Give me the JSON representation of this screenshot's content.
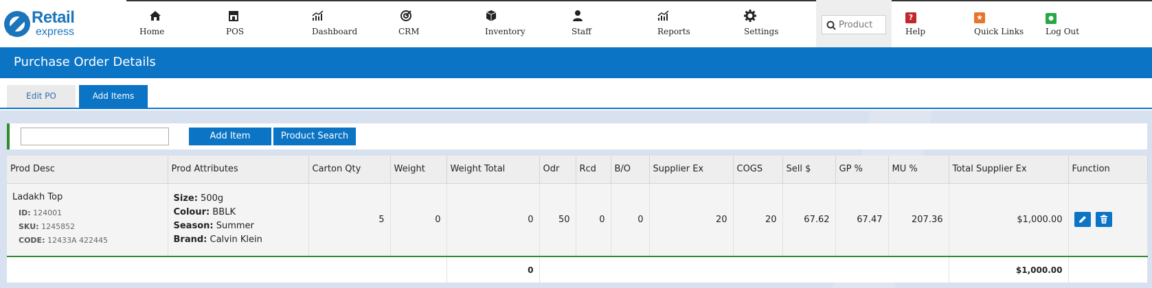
{
  "brand": {
    "line1": "Retail",
    "line2": "express"
  },
  "nav": {
    "items": [
      {
        "label": "Home",
        "icon": "home-icon"
      },
      {
        "label": "POS",
        "icon": "store-icon"
      },
      {
        "label": "Dashboard",
        "icon": "bar-chart-icon"
      },
      {
        "label": "CRM",
        "icon": "target-icon"
      },
      {
        "label": "Inventory",
        "icon": "box-icon"
      },
      {
        "label": "Staff",
        "icon": "user-icon"
      },
      {
        "label": "Reports",
        "icon": "bar-chart-icon"
      },
      {
        "label": "Settings",
        "icon": "gear-icon"
      }
    ],
    "search_placeholder": "Product",
    "right_items": [
      {
        "label": "Help",
        "icon": "help-icon",
        "color": "#c0282d",
        "glyph": "?"
      },
      {
        "label": "Quick Links",
        "icon": "star-icon",
        "color": "#e8742a",
        "glyph": "★"
      },
      {
        "label": "Log Out",
        "icon": "logout-user-icon",
        "color": "#28a745",
        "glyph": "●"
      }
    ]
  },
  "page": {
    "title": "Purchase Order Details"
  },
  "tabs": [
    {
      "label": "Edit PO",
      "active": false
    },
    {
      "label": "Add Items",
      "active": true
    }
  ],
  "toolbar": {
    "input_value": "",
    "add_item_label": "Add Item",
    "product_search_label": "Product Search"
  },
  "table": {
    "headers": [
      "Prod Desc",
      "Prod Attributes",
      "Carton Qty",
      "Weight",
      "Weight Total",
      "Odr",
      "Rcd",
      "B/O",
      "Supplier Ex",
      "COGS",
      "Sell $",
      "GP %",
      "MU %",
      "Total Supplier Ex",
      "Function"
    ],
    "rows": [
      {
        "name": "Ladakh Top",
        "id_label": "ID:",
        "id": "124001",
        "sku_label": "SKU:",
        "sku": "1245852",
        "code_label": "CODE:",
        "code": "12433A 422445",
        "attributes": [
          {
            "key": "Size:",
            "value": "500g"
          },
          {
            "key": "Colour:",
            "value": "BBLK"
          },
          {
            "key": "Season:",
            "value": "Summer"
          },
          {
            "key": "Brand:",
            "value": "Calvin Klein"
          }
        ],
        "carton_qty": "5",
        "weight": "0",
        "weight_total": "0",
        "odr": "50",
        "rcd": "0",
        "bo": "0",
        "supplier_ex": "20",
        "cogs": "20",
        "sell": "67.62",
        "gp": "67.47",
        "mu": "207.36",
        "total_supplier_ex": "$1,000.00"
      }
    ],
    "totals": {
      "weight_total": "0",
      "total_supplier_ex": "$1,000.00"
    }
  },
  "colors": {
    "primary": "#0b74c4",
    "accent_green": "#2e8b2e",
    "content_bg": "#d8e1ef"
  }
}
